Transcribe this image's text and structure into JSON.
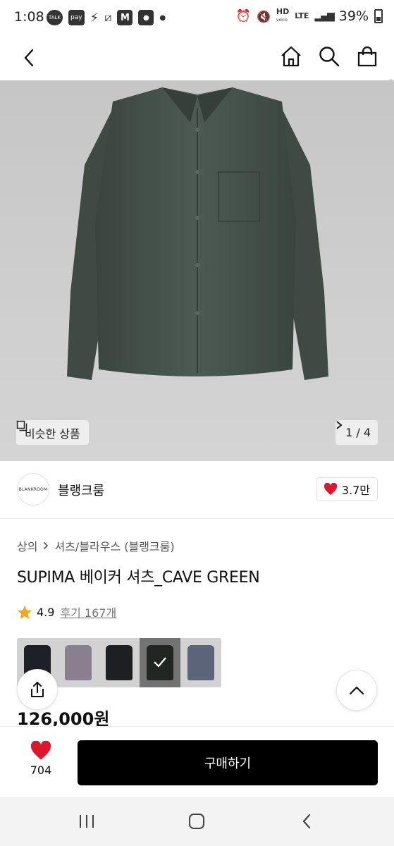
{
  "status_bar": {
    "time": "1:08",
    "notif_icons": [
      "talk-icon",
      "pay-icon",
      "bolt-icon",
      "lock-icon",
      "gmail-icon",
      "app-icon",
      "dot-icon"
    ],
    "talk_label": "TALK",
    "pay_label": "pay",
    "hd_label": "HD",
    "voice_label": "voice",
    "lte_label": "LTE",
    "battery": "39%"
  },
  "app_bar": {
    "icons": [
      "back-icon",
      "home-icon",
      "search-icon",
      "bag-icon"
    ]
  },
  "hero": {
    "similar_label": "비슷한 상품",
    "pager": "1 / 4",
    "shirt_color": "#4a5750"
  },
  "brand": {
    "logo_text": "BLANKROOM",
    "name": "블랭크룸",
    "likes": "3.7만"
  },
  "product": {
    "breadcrumb_category": "상의",
    "breadcrumb_sub": "셔츠/블라우스 (블랭크룸)",
    "title": "SUPIMA 베이커 셔츠_CAVE GREEN",
    "rating": "4.9",
    "reviews": "후기 167개",
    "price": "126,000원",
    "swatch_colors": [
      "#1d2026",
      "#8a7f8e",
      "#1e1f21",
      "#3d463f",
      "#5b6479"
    ],
    "selected_swatch": 3
  },
  "buy_bar": {
    "wish_count": "704",
    "buy_label": "구매하기"
  },
  "colors": {
    "accent_red": "#e0162b",
    "star": "#f5a623",
    "button_black": "#000000"
  }
}
